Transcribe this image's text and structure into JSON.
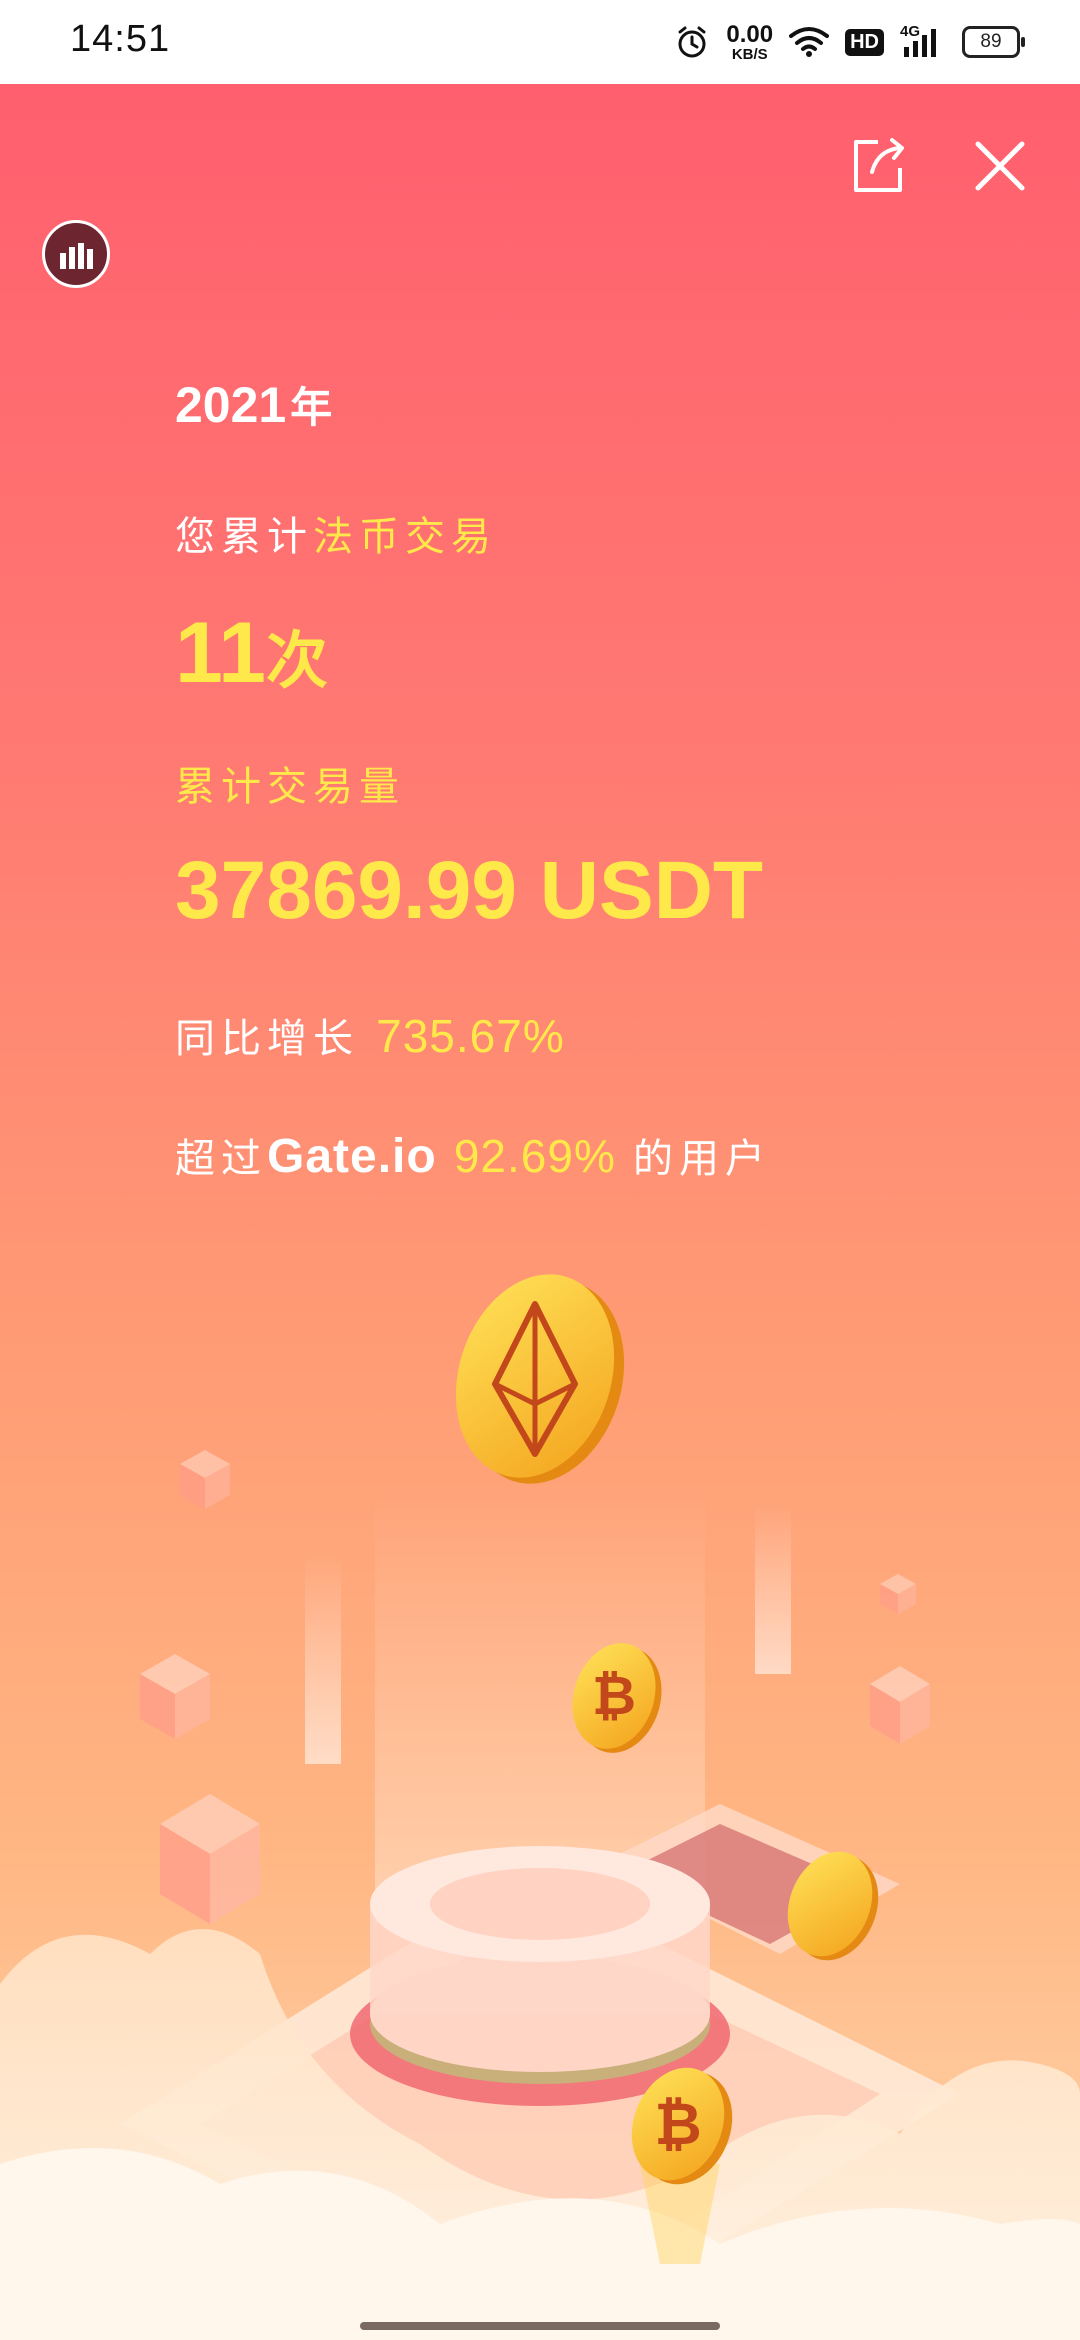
{
  "status_bar": {
    "time": "14:51",
    "net_speed_value": "0.00",
    "net_speed_unit": "KB/S",
    "hd": "HD",
    "network": "4G",
    "battery": "89"
  },
  "panel": {
    "year": "2021",
    "year_suffix": "年",
    "intro_prefix": "您累计",
    "intro_highlight": "法币交易",
    "count_value": "11",
    "count_unit": "次",
    "volume_label": "累计交易量",
    "volume_value": "37869.99 USDT",
    "growth_label": "同比增长",
    "growth_value": "735.67%",
    "beyond_label": "超过",
    "brand": "Gate.io",
    "beyond_value": "92.69%",
    "beyond_suffix": "的用户"
  },
  "colors": {
    "accent_yellow": "#ffe84a",
    "bg_top": "#ff5f6e",
    "bg_bottom": "#ffd9b0",
    "stats_button": "#6d2530"
  },
  "icons": [
    "alarm-icon",
    "wifi-icon",
    "signal-icon",
    "battery-icon",
    "share-icon",
    "close-icon",
    "bar-chart-icon",
    "ethereum-coin-icon",
    "bitcoin-coin-icon"
  ]
}
